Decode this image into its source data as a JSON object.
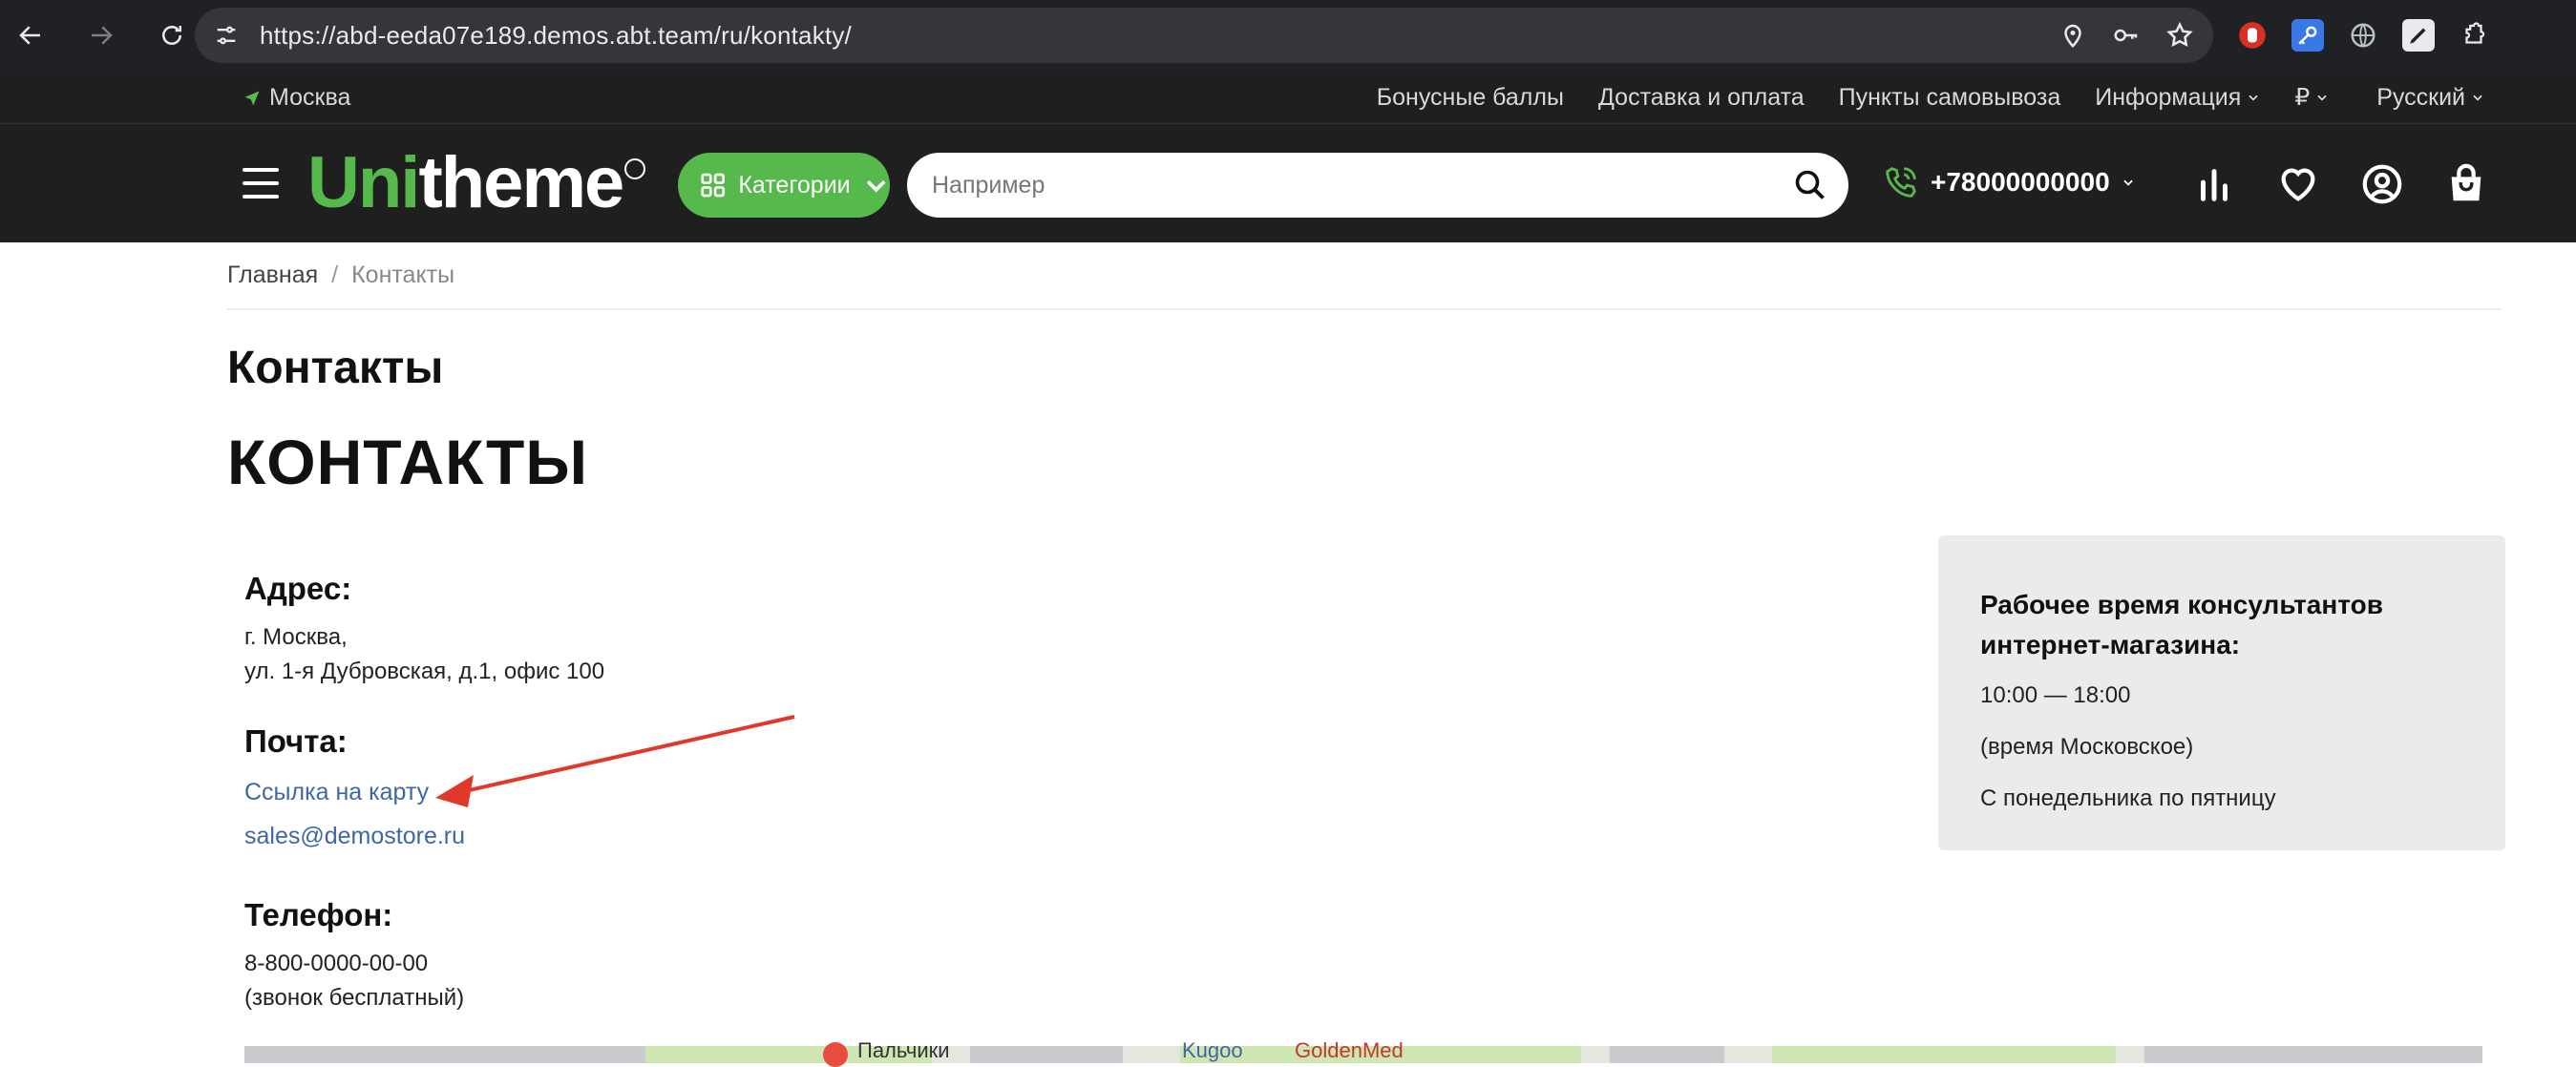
{
  "browser": {
    "url": "https://abd-eeda07e189.demos.abt.team/ru/kontakty/"
  },
  "top_strip": {
    "city": "Москва",
    "links": [
      {
        "label": "Бонусные баллы"
      },
      {
        "label": "Доставка и оплата"
      },
      {
        "label": "Пункты самовывоза"
      },
      {
        "label": "Информация"
      },
      {
        "label": "₽"
      },
      {
        "label": "Русский"
      }
    ]
  },
  "header": {
    "logo_uni": "Uni",
    "logo_rest": "theme",
    "categories_label": "Категории",
    "search_placeholder": "Например",
    "phone": "+78000000000"
  },
  "breadcrumb": {
    "home": "Главная",
    "separator": "/",
    "current": "Контакты"
  },
  "page": {
    "title": "Контакты",
    "content_title": "КОНТАКТЫ"
  },
  "contacts": {
    "address_heading": "Адрес:",
    "address_line1": "г. Москва,",
    "address_line2": "ул. 1-я Дубровская, д.1, офис 100",
    "mail_heading": "Почта:",
    "map_link": "Ссылка на карту",
    "email": "sales@demostore.ru",
    "phone_heading": "Телефон:",
    "phone_number": "8-800-0000-00-00",
    "phone_note": "(звонок бесплатный)"
  },
  "hours": {
    "title": "Рабочее время консультантов интернет-магазина:",
    "time": "10:00 — 18:00",
    "timezone": "(время Московское)",
    "days": "С понедельника по пятницу"
  },
  "map": {
    "labels": [
      "Пальчики",
      "Kugoo",
      "GoldenMed"
    ]
  },
  "colors": {
    "brand_green": "#55b94c",
    "header_bg": "#1f1f1f",
    "link_blue": "#3f67a6",
    "annotation_red": "#e0392b"
  }
}
